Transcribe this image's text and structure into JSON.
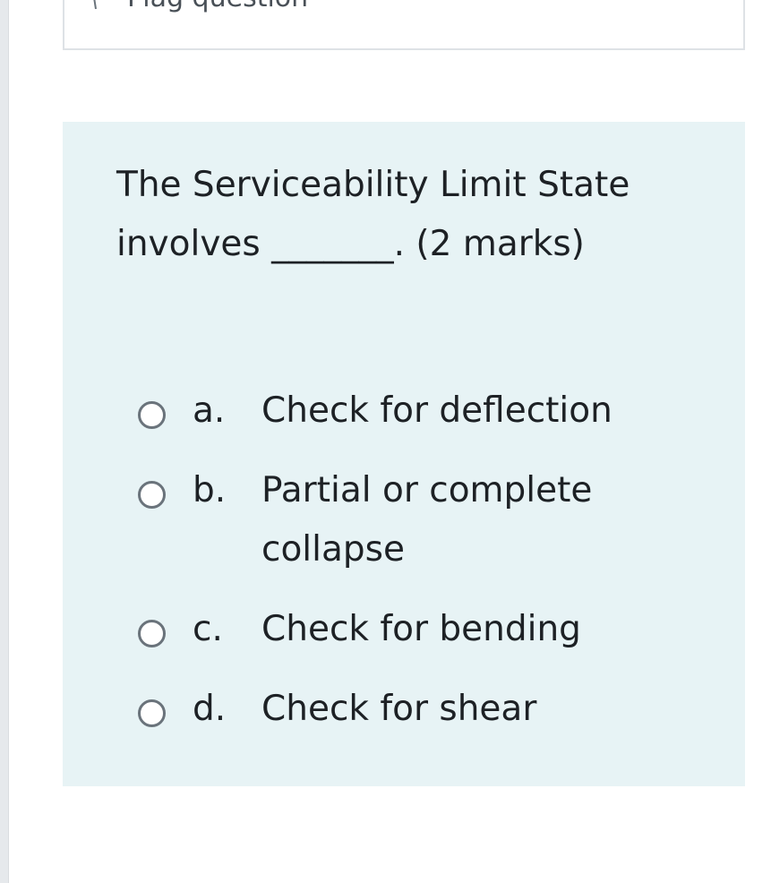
{
  "flag": {
    "label": "Flag question",
    "icon": "flag-icon"
  },
  "question": {
    "text": "The Serviceability Limit State involves _______. (2 marks)"
  },
  "answers": [
    {
      "letter": "a.",
      "text": "Check for deflection",
      "selected": false
    },
    {
      "letter": "b.",
      "text": "Partial or complete collapse",
      "selected": false
    },
    {
      "letter": "c.",
      "text": "Check for bending",
      "selected": false
    },
    {
      "letter": "d.",
      "text": "Check for shear",
      "selected": false
    }
  ],
  "colors": {
    "question_background": "#e7f3f5",
    "text": "#1d2125",
    "radio_border": "#6a737b"
  }
}
